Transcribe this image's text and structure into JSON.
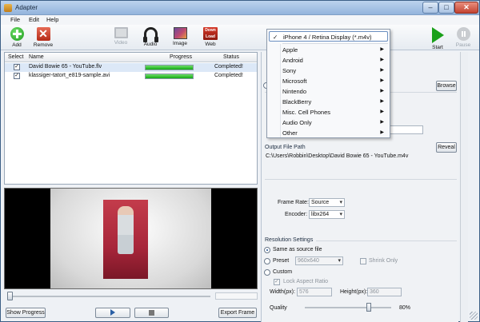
{
  "window": {
    "title": "Adapter"
  },
  "menu": [
    "File",
    "Edit",
    "Help"
  ],
  "toolbar": {
    "add": "Add",
    "remove": "Remove",
    "video": "Video",
    "audio": "Audio",
    "image": "Image",
    "web": "Web",
    "web_icon_line1": "Down",
    "web_icon_line2": "Load",
    "start": "Start",
    "pause": "Pause"
  },
  "file_list": {
    "columns": {
      "select": "Select",
      "name": "Name",
      "progress": "Progress",
      "status": "Status"
    },
    "rows": [
      {
        "checked": true,
        "name": "David Bowie 65 - YouTube.flv",
        "progress": 1.0,
        "status": "Completed!"
      },
      {
        "checked": true,
        "name": "klassiger-tatort_e819-sample.avi",
        "progress": 1.0,
        "status": "Completed!"
      }
    ]
  },
  "preview_controls": {
    "show_progress": "Show Progress",
    "export_frame": "Export Frame"
  },
  "settings": {
    "browse": "Browse",
    "output_file_path_label": "Output File Path",
    "output_file_path": "C:\\Users\\Robbin\\Desktop\\David Bowie 65 - YouTube.m4v",
    "reveal": "Reveal",
    "frame_rate_label": "Frame Rate:",
    "frame_rate_value": "Source",
    "encoder_label": "Encoder:",
    "encoder_value": "libx264",
    "resolution_settings": "Resolution Settings",
    "same_as_source": "Same as source file",
    "preset": "Preset",
    "preset_value": "960x640",
    "shrink_only": "Shrink Only",
    "custom": "Custom",
    "lock_aspect": "Lock Aspect Ratio",
    "width_label": "Width(px):",
    "width_value": "576",
    "height_label": "Height(px):",
    "height_value": "360",
    "quality_label": "Quality",
    "quality_value": "80%",
    "quality": 0.8
  },
  "format_menu": {
    "selected": "iPhone 4 / Retina Display (*.m4v)",
    "items": [
      "Apple",
      "Android",
      "Sony",
      "Microsoft",
      "Nintendo",
      "BlackBerry",
      "Misc. Cell Phones",
      "Audio Only",
      "Other"
    ]
  },
  "colors": {
    "progress_fill": "#14a814",
    "start_green": "#1aa01a",
    "accent": "#2a5fa5"
  }
}
